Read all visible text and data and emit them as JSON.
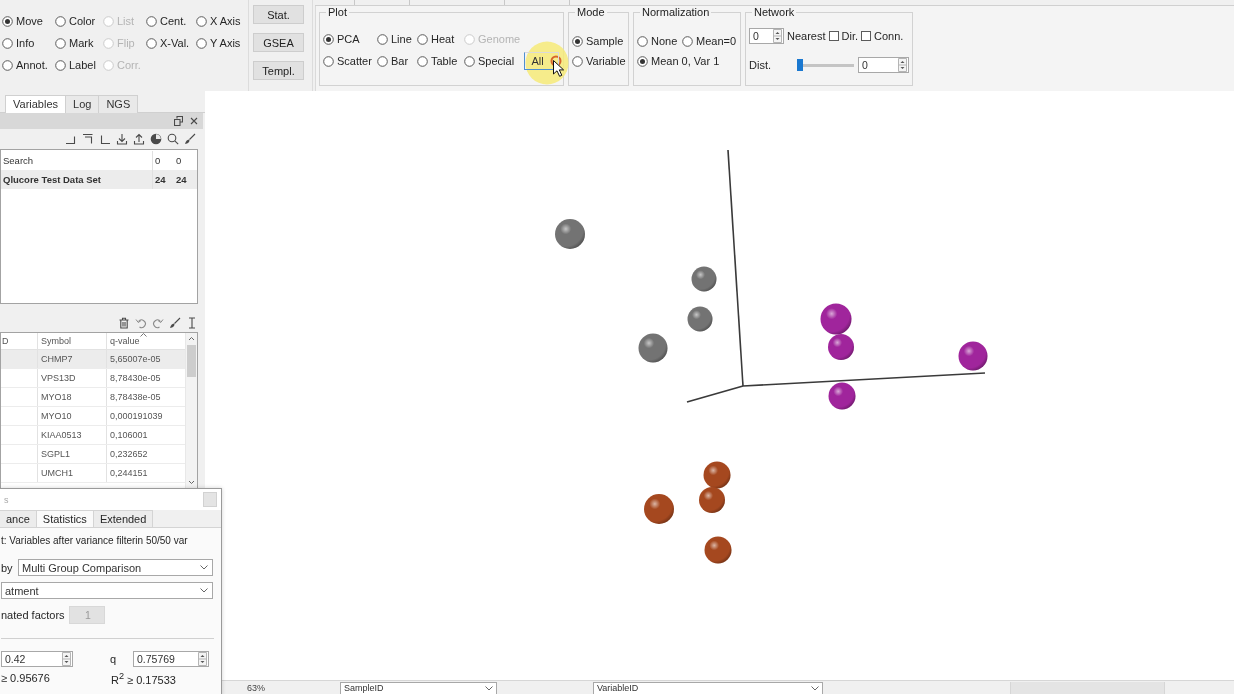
{
  "toolbar": {
    "tools": [
      {
        "label": "Move",
        "selected": true,
        "disabled": false
      },
      {
        "label": "Color",
        "selected": false,
        "disabled": false
      },
      {
        "label": "List",
        "selected": false,
        "disabled": true
      },
      {
        "label": "Cent.",
        "selected": false,
        "disabled": false
      },
      {
        "label": "X Axis",
        "selected": false,
        "disabled": false
      },
      {
        "label": "Info",
        "selected": false,
        "disabled": false
      },
      {
        "label": "Mark",
        "selected": false,
        "disabled": false
      },
      {
        "label": "Flip",
        "selected": false,
        "disabled": true
      },
      {
        "label": "X-Val.",
        "selected": false,
        "disabled": false
      },
      {
        "label": "Y Axis",
        "selected": false,
        "disabled": false
      },
      {
        "label": "Annot.",
        "selected": false,
        "disabled": false
      },
      {
        "label": "Label",
        "selected": false,
        "disabled": false
      },
      {
        "label": "Corr.",
        "selected": false,
        "disabled": true
      }
    ],
    "buttons": [
      "Stat.",
      "GSEA",
      "Templ."
    ]
  },
  "plot_group": {
    "title": "Plot",
    "types": [
      {
        "label": "PCA",
        "selected": true,
        "disabled": false
      },
      {
        "label": "Line",
        "selected": false,
        "disabled": false
      },
      {
        "label": "Heat",
        "selected": false,
        "disabled": false
      },
      {
        "label": "Genome",
        "selected": false,
        "disabled": true
      },
      {
        "label": "Scatter",
        "selected": false,
        "disabled": false
      },
      {
        "label": "Bar",
        "selected": false,
        "disabled": false
      },
      {
        "label": "Table",
        "selected": false,
        "disabled": false
      },
      {
        "label": "Special",
        "selected": false,
        "disabled": false
      }
    ],
    "button": "All"
  },
  "mode_group": {
    "title": "Mode",
    "options": [
      {
        "label": "Sample",
        "selected": true
      },
      {
        "label": "Variable",
        "selected": false
      }
    ]
  },
  "normalization_group": {
    "title": "Normalization",
    "options": [
      {
        "label": "None",
        "selected": false
      },
      {
        "label": "Mean=0",
        "selected": false
      },
      {
        "label": "Mean 0, Var 1",
        "selected": true
      }
    ]
  },
  "network_group": {
    "title": "Network",
    "nearest": {
      "value": "0",
      "label": "Nearest"
    },
    "checkboxes": [
      {
        "label": "Dir.",
        "checked": false
      },
      {
        "label": "Conn.",
        "checked": false
      }
    ],
    "distance": {
      "label": "Dist.",
      "level": 0,
      "value": "0"
    }
  },
  "side_panel": {
    "tabs": [
      {
        "label": "Variables",
        "selected": true
      },
      {
        "label": "Log",
        "selected": false
      },
      {
        "label": "NGS",
        "selected": false
      }
    ],
    "data_sets": [
      {
        "name": "Search",
        "count": "0",
        "total": "0",
        "selected": false
      },
      {
        "name": "Qlucore Test Data Set",
        "count": "24",
        "total": "24",
        "selected": true
      }
    ],
    "table": {
      "columns": [
        {
          "label": "D",
          "sorted": false
        },
        {
          "label": "Symbol",
          "sorted": false
        },
        {
          "label": "q-value",
          "sorted": true
        }
      ],
      "rows": [
        {
          "symbol": "CHMP7",
          "q_value": "5,65007e-05",
          "selected": true
        },
        {
          "symbol": "VPS13D",
          "q_value": "8,78430e-05",
          "selected": false
        },
        {
          "symbol": "MYO18",
          "q_value": "8,78438e-05",
          "selected": false
        },
        {
          "symbol": "MYO10",
          "q_value": "0,000191039",
          "selected": false
        },
        {
          "symbol": "KIAA0513",
          "q_value": "0,106001",
          "selected": false
        },
        {
          "symbol": "SGPL1",
          "q_value": "0,232652",
          "selected": false
        },
        {
          "symbol": "UMCH1",
          "q_value": "0,244151",
          "selected": false
        }
      ]
    }
  },
  "pca_plot": {
    "samples": [
      {
        "color": "#737373"
      },
      {
        "color": "#737373"
      },
      {
        "color": "#737373"
      },
      {
        "color": "#a0259c"
      },
      {
        "color": "#a0259c"
      },
      {
        "color": "#737373"
      },
      {
        "color": "#a0259c"
      },
      {
        "color": "#a0259c"
      },
      {
        "color": "#a5481f"
      },
      {
        "color": "#a5481f"
      },
      {
        "color": "#a5481f"
      },
      {
        "color": "#a5481f"
      }
    ]
  },
  "dialog": {
    "title": "s",
    "tabs": [
      {
        "label": "ance",
        "selected": false
      },
      {
        "label": "Statistics",
        "selected": true
      },
      {
        "label": "Extended",
        "selected": false
      }
    ],
    "subset": "t: Variables after variance filterin 50/50 var",
    "test": {
      "label": "by",
      "value": "Multi Group Comparison"
    },
    "factor": "atment",
    "eliminated_factors": {
      "label": "nated factors",
      "value": "1",
      "disabled": true
    },
    "p_value": "0.42",
    "q": {
      "label": "q",
      "value": "0.75769"
    },
    "r2_low": "≥ 0.95676",
    "r2_high": "R$^{2}$ ≥ 0.17533"
  },
  "status_bar": {
    "zoom": "63%",
    "sample_field": "SampleID",
    "variable_field": "VariableID"
  }
}
